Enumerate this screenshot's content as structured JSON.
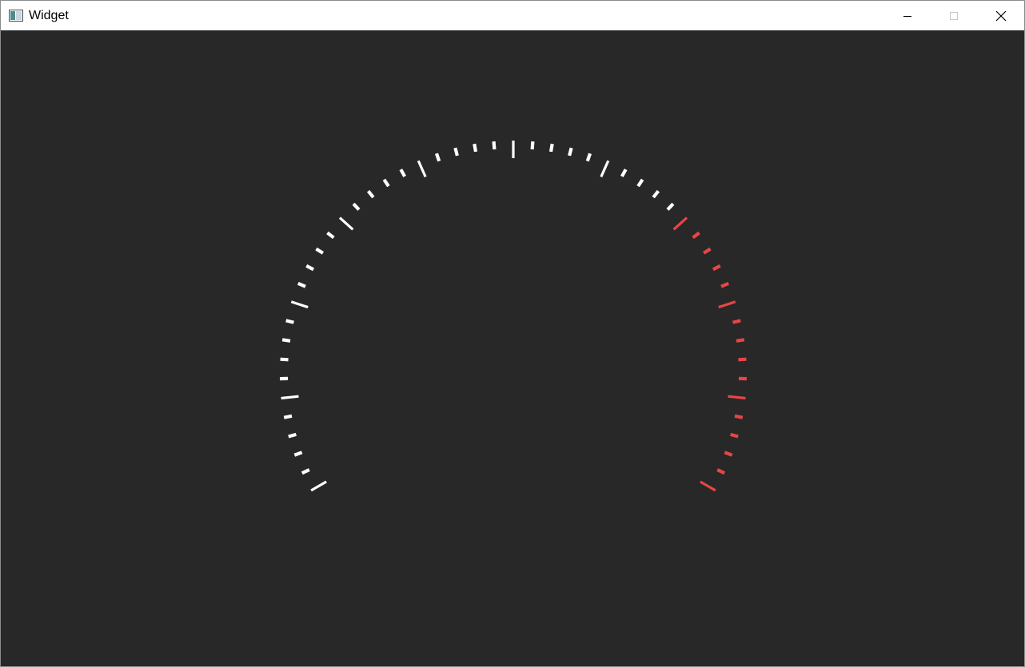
{
  "window": {
    "title": "Widget",
    "app_icon": "app-window-icon",
    "controls": {
      "minimize_icon": "minimize-icon",
      "maximize_icon": "maximize-icon",
      "close_icon": "close-icon"
    }
  },
  "client": {
    "background": "#282828"
  },
  "gauge": {
    "start_angle_deg": 210,
    "end_angle_deg": -30,
    "major_tick_count": 11,
    "minor_per_major": 5,
    "normal_color": "#ffffff",
    "danger_color": "#e84545",
    "danger_start_fraction": 0.7
  }
}
